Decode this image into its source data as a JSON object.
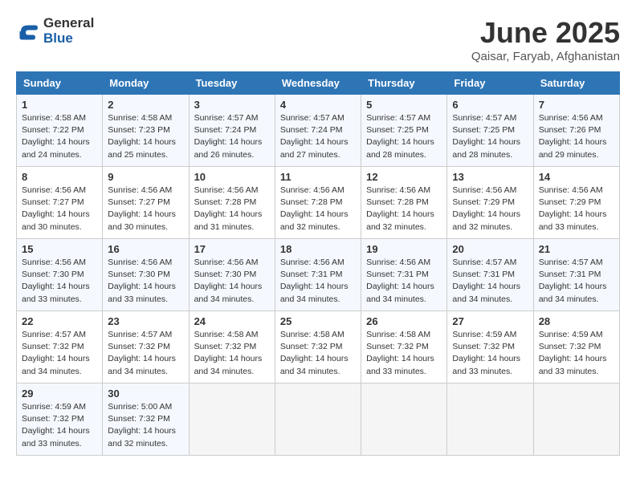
{
  "logo": {
    "line1": "General",
    "line2": "Blue"
  },
  "title": "June 2025",
  "location": "Qaisar, Faryab, Afghanistan",
  "days_of_week": [
    "Sunday",
    "Monday",
    "Tuesday",
    "Wednesday",
    "Thursday",
    "Friday",
    "Saturday"
  ],
  "weeks": [
    [
      {
        "day": "1",
        "sunrise": "4:58 AM",
        "sunset": "7:22 PM",
        "daylight": "14 hours and 24 minutes."
      },
      {
        "day": "2",
        "sunrise": "4:58 AM",
        "sunset": "7:23 PM",
        "daylight": "14 hours and 25 minutes."
      },
      {
        "day": "3",
        "sunrise": "4:57 AM",
        "sunset": "7:24 PM",
        "daylight": "14 hours and 26 minutes."
      },
      {
        "day": "4",
        "sunrise": "4:57 AM",
        "sunset": "7:24 PM",
        "daylight": "14 hours and 27 minutes."
      },
      {
        "day": "5",
        "sunrise": "4:57 AM",
        "sunset": "7:25 PM",
        "daylight": "14 hours and 28 minutes."
      },
      {
        "day": "6",
        "sunrise": "4:57 AM",
        "sunset": "7:25 PM",
        "daylight": "14 hours and 28 minutes."
      },
      {
        "day": "7",
        "sunrise": "4:56 AM",
        "sunset": "7:26 PM",
        "daylight": "14 hours and 29 minutes."
      }
    ],
    [
      {
        "day": "8",
        "sunrise": "4:56 AM",
        "sunset": "7:27 PM",
        "daylight": "14 hours and 30 minutes."
      },
      {
        "day": "9",
        "sunrise": "4:56 AM",
        "sunset": "7:27 PM",
        "daylight": "14 hours and 30 minutes."
      },
      {
        "day": "10",
        "sunrise": "4:56 AM",
        "sunset": "7:28 PM",
        "daylight": "14 hours and 31 minutes."
      },
      {
        "day": "11",
        "sunrise": "4:56 AM",
        "sunset": "7:28 PM",
        "daylight": "14 hours and 32 minutes."
      },
      {
        "day": "12",
        "sunrise": "4:56 AM",
        "sunset": "7:28 PM",
        "daylight": "14 hours and 32 minutes."
      },
      {
        "day": "13",
        "sunrise": "4:56 AM",
        "sunset": "7:29 PM",
        "daylight": "14 hours and 32 minutes."
      },
      {
        "day": "14",
        "sunrise": "4:56 AM",
        "sunset": "7:29 PM",
        "daylight": "14 hours and 33 minutes."
      }
    ],
    [
      {
        "day": "15",
        "sunrise": "4:56 AM",
        "sunset": "7:30 PM",
        "daylight": "14 hours and 33 minutes."
      },
      {
        "day": "16",
        "sunrise": "4:56 AM",
        "sunset": "7:30 PM",
        "daylight": "14 hours and 33 minutes."
      },
      {
        "day": "17",
        "sunrise": "4:56 AM",
        "sunset": "7:30 PM",
        "daylight": "14 hours and 34 minutes."
      },
      {
        "day": "18",
        "sunrise": "4:56 AM",
        "sunset": "7:31 PM",
        "daylight": "14 hours and 34 minutes."
      },
      {
        "day": "19",
        "sunrise": "4:56 AM",
        "sunset": "7:31 PM",
        "daylight": "14 hours and 34 minutes."
      },
      {
        "day": "20",
        "sunrise": "4:57 AM",
        "sunset": "7:31 PM",
        "daylight": "14 hours and 34 minutes."
      },
      {
        "day": "21",
        "sunrise": "4:57 AM",
        "sunset": "7:31 PM",
        "daylight": "14 hours and 34 minutes."
      }
    ],
    [
      {
        "day": "22",
        "sunrise": "4:57 AM",
        "sunset": "7:32 PM",
        "daylight": "14 hours and 34 minutes."
      },
      {
        "day": "23",
        "sunrise": "4:57 AM",
        "sunset": "7:32 PM",
        "daylight": "14 hours and 34 minutes."
      },
      {
        "day": "24",
        "sunrise": "4:58 AM",
        "sunset": "7:32 PM",
        "daylight": "14 hours and 34 minutes."
      },
      {
        "day": "25",
        "sunrise": "4:58 AM",
        "sunset": "7:32 PM",
        "daylight": "14 hours and 34 minutes."
      },
      {
        "day": "26",
        "sunrise": "4:58 AM",
        "sunset": "7:32 PM",
        "daylight": "14 hours and 33 minutes."
      },
      {
        "day": "27",
        "sunrise": "4:59 AM",
        "sunset": "7:32 PM",
        "daylight": "14 hours and 33 minutes."
      },
      {
        "day": "28",
        "sunrise": "4:59 AM",
        "sunset": "7:32 PM",
        "daylight": "14 hours and 33 minutes."
      }
    ],
    [
      {
        "day": "29",
        "sunrise": "4:59 AM",
        "sunset": "7:32 PM",
        "daylight": "14 hours and 33 minutes."
      },
      {
        "day": "30",
        "sunrise": "5:00 AM",
        "sunset": "7:32 PM",
        "daylight": "14 hours and 32 minutes."
      },
      null,
      null,
      null,
      null,
      null
    ]
  ]
}
